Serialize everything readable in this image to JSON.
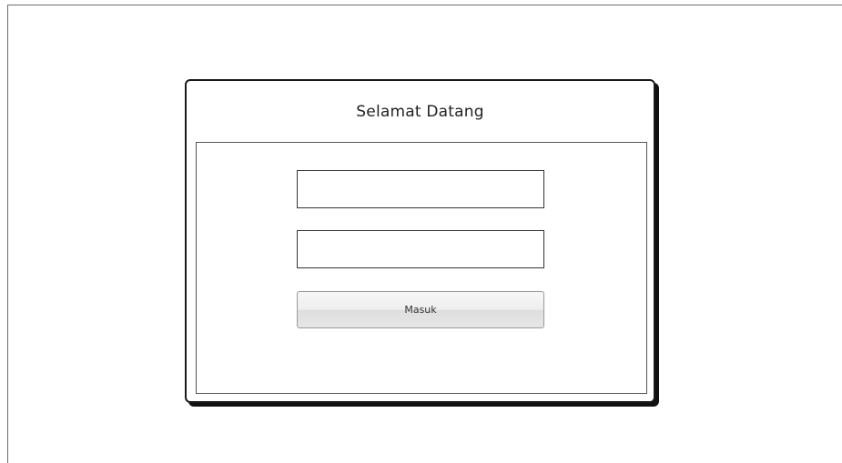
{
  "dialog": {
    "title": "Selamat Datang",
    "fields": [
      {
        "value": "",
        "placeholder": ""
      },
      {
        "value": "",
        "placeholder": ""
      }
    ],
    "submit_label": "Masuk"
  },
  "colors": {
    "background": "#ffffff",
    "border": "#1a1a1a",
    "button_fill": "#eeeeee",
    "text": "#222222"
  }
}
